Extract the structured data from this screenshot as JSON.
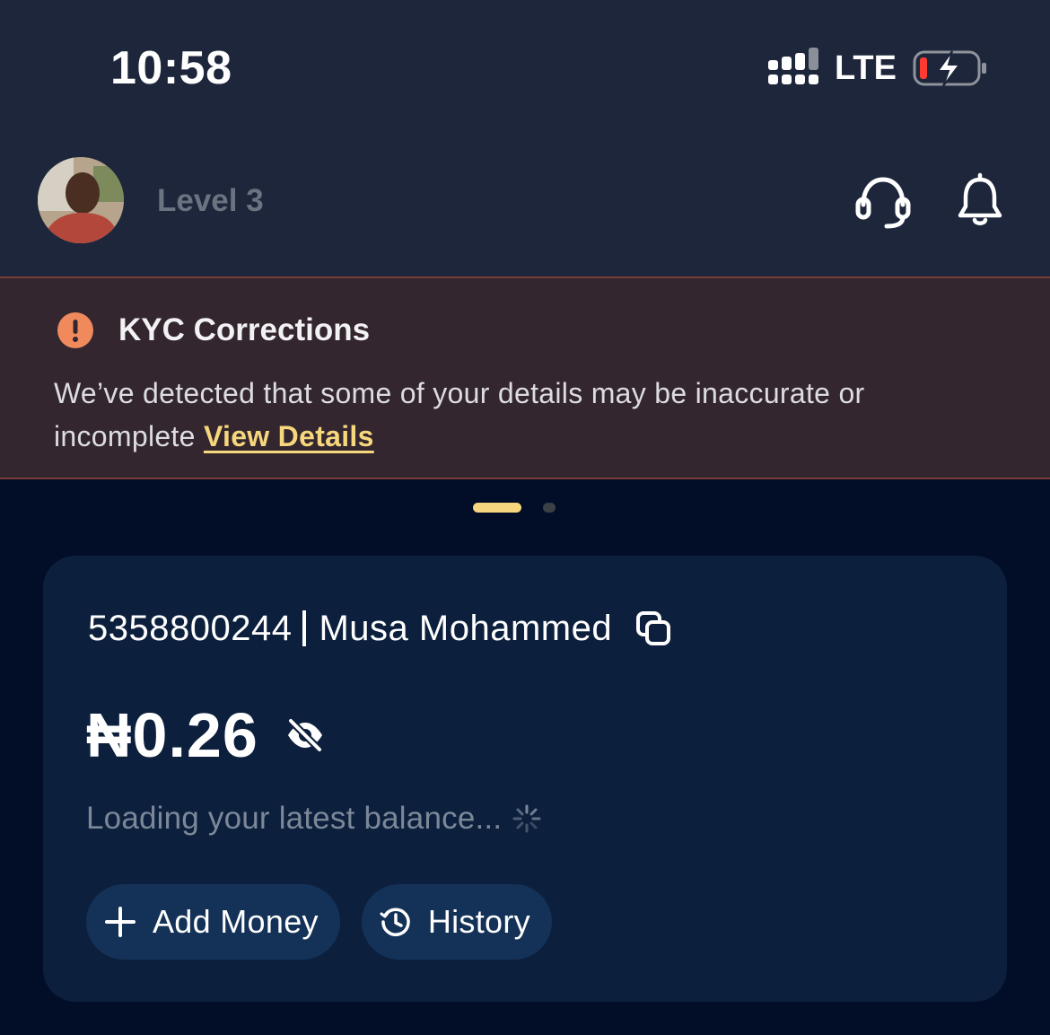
{
  "status_bar": {
    "time": "10:58",
    "network": "LTE",
    "icons": [
      "signal-icon",
      "battery-charging-icon"
    ]
  },
  "header": {
    "level": "Level 3",
    "icons": [
      "avatar",
      "headset-support-icon",
      "bell-icon"
    ]
  },
  "kyc_banner": {
    "title": "KYC Corrections",
    "message": "We’ve detected that some of your details may be inaccurate or incomplete",
    "link": "View Details",
    "icon": "alert-icon",
    "accent_color": "#f08a5d",
    "link_color": "#f6d77d"
  },
  "pager": {
    "active_index": 0,
    "count": 2
  },
  "account": {
    "number": "5358800244",
    "name": "Musa Mohammed",
    "balance": "₦0.26",
    "loading_text": "Loading your latest balance...",
    "icons": [
      "copy-icon",
      "eye-off-icon",
      "spinner-icon"
    ]
  },
  "actions": {
    "add_money": "Add Money",
    "history": "History",
    "icons": [
      "plus-icon",
      "history-icon"
    ]
  },
  "colors": {
    "background": "#020e27",
    "header": "#1d263b",
    "card": "#0c1f3d",
    "button": "#143257",
    "banner": "#33262f"
  }
}
